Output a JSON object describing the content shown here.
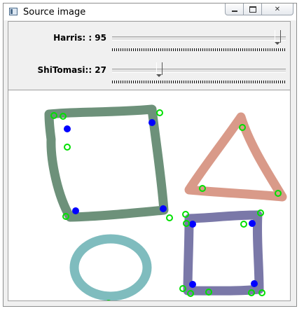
{
  "window": {
    "title": "Source image",
    "icon": "app-window-icon",
    "controls": [
      "minimize-icon",
      "maximize-icon",
      "close-icon"
    ]
  },
  "trackbars": [
    {
      "label": "Harris: : 95",
      "name": "Harris",
      "value": 95,
      "max": 100
    },
    {
      "label": "ShiTomasi:: 27",
      "name": "ShiTomasi",
      "value": 27,
      "max": 100
    }
  ],
  "image": {
    "shapes": [
      {
        "kind": "square",
        "color": "#6d917a"
      },
      {
        "kind": "triangle",
        "color": "#d99a89"
      },
      {
        "kind": "circle",
        "color": "#7fbcbe"
      },
      {
        "kind": "square",
        "color": "#7a78a8"
      }
    ],
    "colors": {
      "harris_corner": "#0000ff",
      "shitomasi_corner": "#00e000"
    }
  }
}
